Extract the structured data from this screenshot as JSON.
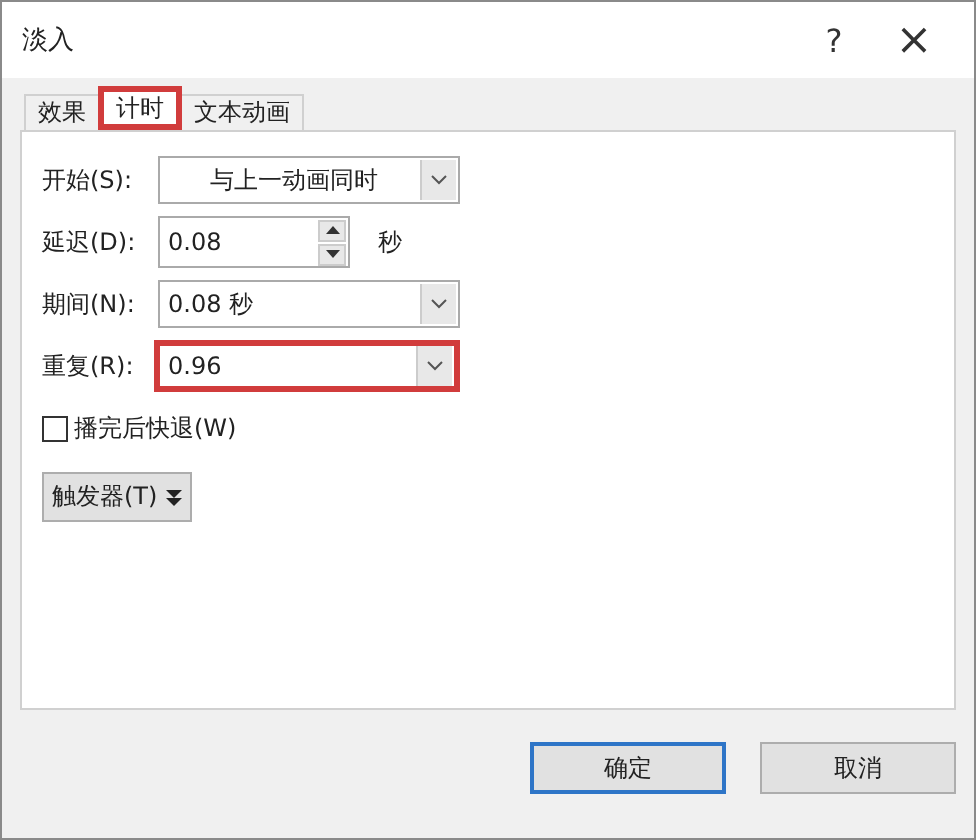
{
  "window": {
    "title": "淡入",
    "help": "?",
    "close": "×"
  },
  "tabs": [
    {
      "label": "效果",
      "selected": false,
      "highlighted": false
    },
    {
      "label": "计时",
      "selected": true,
      "highlighted": true
    },
    {
      "label": "文本动画",
      "selected": false,
      "highlighted": false
    }
  ],
  "fields": [
    {
      "kind": "dropdown",
      "label": "开始(S):",
      "value": "与上一动画同时",
      "centered": true,
      "highlighted": false
    },
    {
      "kind": "spin",
      "label": "延迟(D):",
      "value": "0.08",
      "unit": "秒",
      "highlighted": false
    },
    {
      "kind": "dropdown",
      "label": "期间(N):",
      "value": "0.08 秒",
      "centered": false,
      "highlighted": false
    },
    {
      "kind": "dropdown",
      "label": "重复(R):",
      "value": "0.96",
      "centered": false,
      "highlighted": true
    }
  ],
  "rewind": {
    "label": "播完后快退(W)",
    "checked": false
  },
  "trigger": {
    "label": "触发器(T)"
  },
  "buttons": [
    {
      "label": "确定",
      "default": true
    },
    {
      "label": "取消",
      "default": false
    }
  ]
}
